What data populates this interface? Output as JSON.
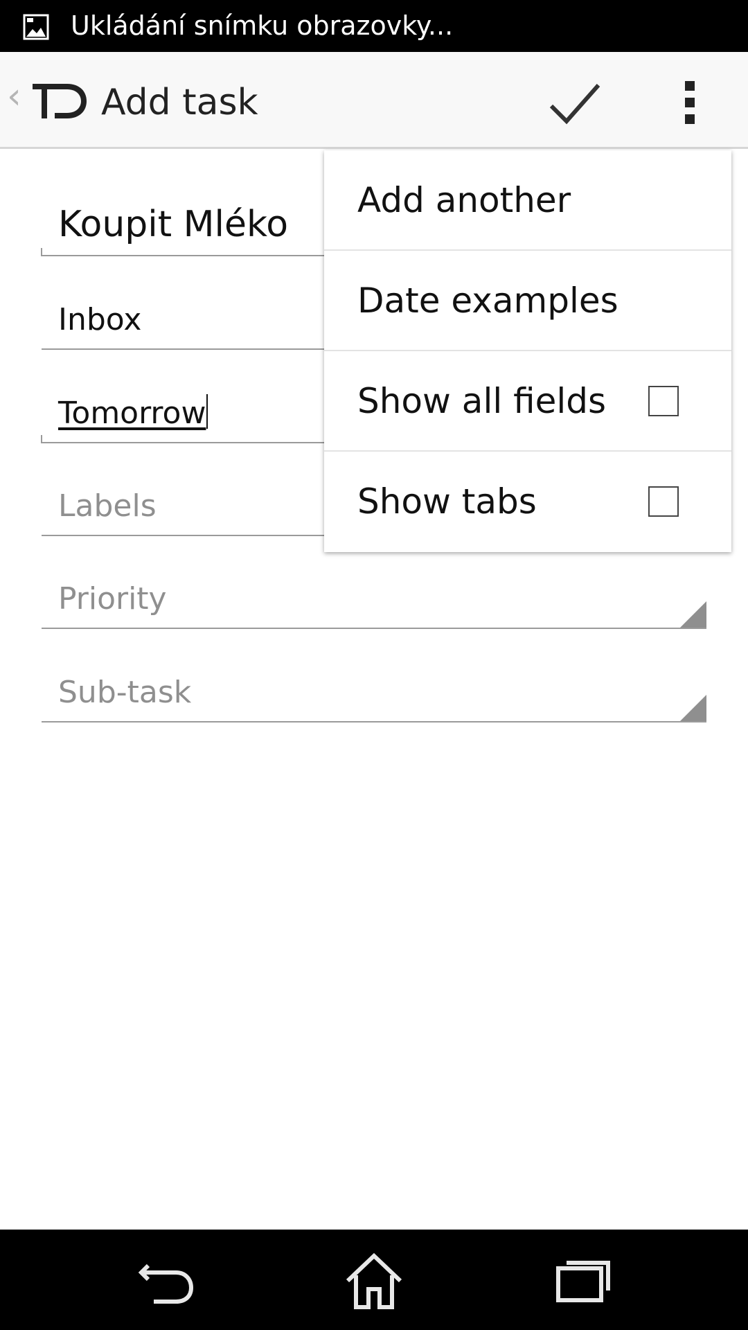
{
  "status_bar": {
    "notification_text": "Ukládání snímku obrazovky...",
    "notification_icon": "image-icon"
  },
  "action_bar": {
    "title": "Add task",
    "back_icon": "chevron-left-icon",
    "logo_icon": "app-logo-icon",
    "confirm_icon": "checkmark-icon",
    "overflow_icon": "overflow-menu-icon"
  },
  "form": {
    "task_name": "Koupit Mléko",
    "project": "Inbox",
    "due_date": "Tomorrow",
    "labels_placeholder": "Labels",
    "priority_placeholder": "Priority",
    "subtask_placeholder": "Sub-task"
  },
  "menu": {
    "items": [
      {
        "label": "Add another",
        "checkbox": false
      },
      {
        "label": "Date examples",
        "checkbox": false
      },
      {
        "label": "Show all fields",
        "checkbox": true,
        "checked": false
      },
      {
        "label": "Show tabs",
        "checkbox": true,
        "checked": false
      }
    ]
  },
  "nav_bar": {
    "back_icon": "back-icon",
    "home_icon": "home-icon",
    "recents_icon": "recent-apps-icon"
  },
  "colors": {
    "status_bar_bg": "#000000",
    "action_bar_bg": "#f8f8f8",
    "hint_text": "#8f8f8f",
    "field_line": "#9a9a9a"
  }
}
